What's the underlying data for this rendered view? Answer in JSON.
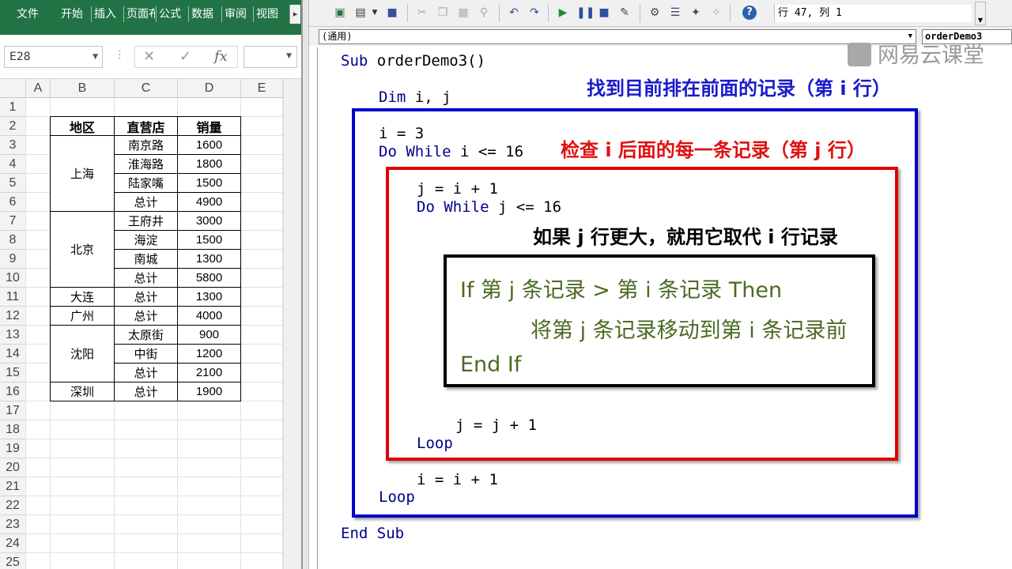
{
  "excel": {
    "ribbon_tabs": [
      "文件",
      "开始",
      "插入",
      "页面布",
      "公式",
      "数据",
      "审阅",
      "视图"
    ],
    "ribbon_more": "▸",
    "name_box": "E28",
    "fx_cancel": "✕",
    "fx_enter": "✓",
    "fx_label": "fx",
    "columns": [
      "A",
      "B",
      "C",
      "D",
      "E"
    ],
    "rows": [
      "1",
      "2",
      "3",
      "4",
      "5",
      "6",
      "7",
      "8",
      "9",
      "10",
      "11",
      "12",
      "13",
      "14",
      "15",
      "16",
      "17",
      "18",
      "19",
      "20",
      "21",
      "22",
      "23",
      "24",
      "25"
    ],
    "table_headers": [
      "地区",
      "直营店",
      "销量"
    ],
    "regions": [
      {
        "name": "上海",
        "stores": [
          [
            "南京路",
            "1600"
          ],
          [
            "淮海路",
            "1800"
          ],
          [
            "陆家嘴",
            "1500"
          ],
          [
            "总计",
            "4900"
          ]
        ]
      },
      {
        "name": "北京",
        "stores": [
          [
            "王府井",
            "3000"
          ],
          [
            "海淀",
            "1500"
          ],
          [
            "南城",
            "1300"
          ],
          [
            "总计",
            "5800"
          ]
        ]
      },
      {
        "name": "大连",
        "stores": [
          [
            "总计",
            "1300"
          ]
        ]
      },
      {
        "name": "广州",
        "stores": [
          [
            "总计",
            "4000"
          ]
        ]
      },
      {
        "name": "沈阳",
        "stores": [
          [
            "太原街",
            "900"
          ],
          [
            "中街",
            "1200"
          ],
          [
            "总计",
            "2100"
          ]
        ]
      },
      {
        "name": "深圳",
        "stores": [
          [
            "总计",
            "1900"
          ]
        ]
      }
    ]
  },
  "vba": {
    "cursor_position": "行 47, 列 1",
    "object_combo": "(通用)",
    "procedure_combo": "orderDemo3",
    "code": {
      "sub_line": [
        "Sub",
        " orderDemo3()"
      ],
      "dim_line": [
        "Dim",
        " i, j"
      ],
      "i_init": "i = 3",
      "outer_loop": [
        "Do While",
        " i <= 16"
      ],
      "j_init": "j = i + 1",
      "inner_loop": [
        "Do While",
        " j <= 16"
      ],
      "j_inc": "j = j + 1",
      "inner_end": "Loop",
      "i_inc": "i = i + 1",
      "outer_end": "Loop",
      "end_sub": "End Sub"
    },
    "annotations": {
      "outer": "找到目前排在前面的记录（第 i 行）",
      "inner": "检查 i 后面的每一条记录（第 j 行）",
      "condition": "如果 j 行更大，就用它取代 i 行记录"
    },
    "pseudocode": {
      "if_line": "If  第 j 条记录 > 第 i 条记录 Then",
      "action_line": "将第 j 条记录移动到第 i 条记录前",
      "end_if": "End If"
    },
    "colors": {
      "outer_box": "#0000cc",
      "inner_box": "#e00000",
      "condition_box": "#000000",
      "outer_text": "#1a1acc",
      "inner_text": "#e01010",
      "pseudo_text": "#4b6a23",
      "keyword": "#00008b"
    }
  },
  "watermark": "网易云课堂"
}
